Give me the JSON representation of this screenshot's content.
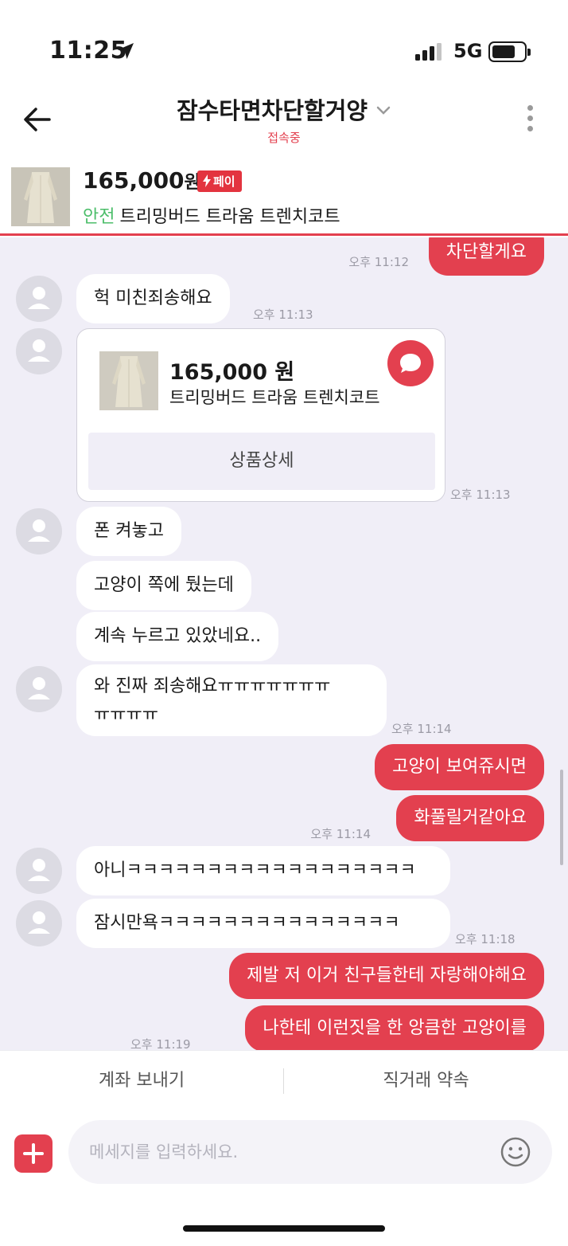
{
  "status_bar": {
    "time": "11:25",
    "network": "5G"
  },
  "header": {
    "title": "잠수타면차단할거양",
    "status": "접속중"
  },
  "product": {
    "price": "165,000",
    "currency": "원",
    "pay_badge": "페이",
    "safe_label": "안전",
    "name": "트리밍버드 트라움 트렌치코트"
  },
  "messages": {
    "m0": {
      "text": "차단할게요",
      "time": "오후 11:12"
    },
    "m1": {
      "text": "헉 미친죄송해요",
      "time": "오후 11:13"
    },
    "card": {
      "price": "165,000 원",
      "name": "트리밍버드 트라움 트렌치코트",
      "button": "상품상세",
      "time": "오후 11:13"
    },
    "m2": {
      "text": "폰 켜놓고"
    },
    "m3": {
      "text": "고양이 쪽에 뒀는데"
    },
    "m4": {
      "text": "계속 누르고 있았네요.."
    },
    "m5": {
      "line1": "와 진짜 죄송해요ㅠㅠㅠㅠㅠㅠㅠ",
      "line2": "ㅠㅠㅠㅠ",
      "time": "오후 11:14"
    },
    "m6": {
      "text": "고양이 보여쥬시면"
    },
    "m7": {
      "text": "화풀릴거같아요",
      "time": "오후 11:14"
    },
    "m8": {
      "text": "아니ㅋㅋㅋㅋㅋㅋㅋㅋㅋㅋㅋㅋㅋㅋㅋㅋㅋㅋ"
    },
    "m9": {
      "text": "잠시만욕ㅋㅋㅋㅋㅋㅋㅋㅋㅋㅋㅋㅋㅋㅋㅋ",
      "time": "오후 11:18"
    },
    "m10": {
      "text": "제발 저 이거 친구들한테 자랑해야해요"
    },
    "m11": {
      "text": "나한테 이런짓을 한 앙큼한 고양이를",
      "time": "오후 11:19"
    }
  },
  "actions": {
    "send_money": "계좌 보내기",
    "direct_deal": "직거래 약속"
  },
  "composer": {
    "placeholder": "메세지를 입력하세요."
  },
  "colors": {
    "accent": "#e3404f",
    "chat_bg": "#f0eef7",
    "safe_green": "#4cbe6a"
  }
}
